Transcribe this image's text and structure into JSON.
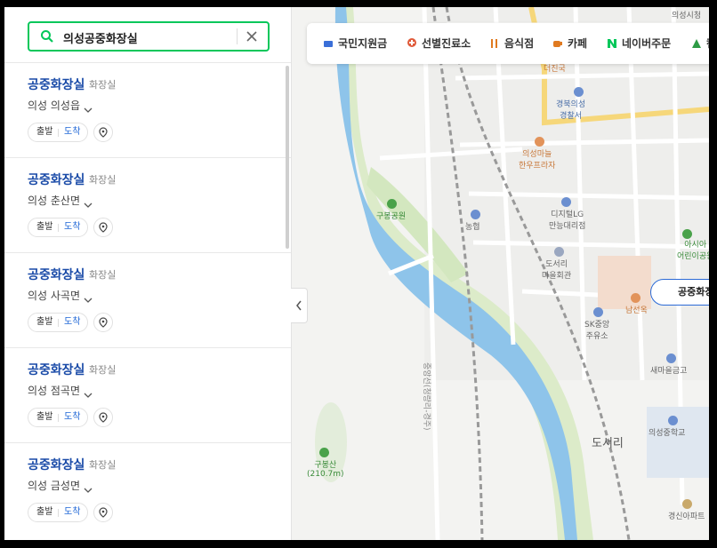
{
  "search": {
    "query": "의성공중화장실"
  },
  "results": [
    {
      "name": "공중화장실",
      "category": "화장실",
      "address": "의성 의성읍",
      "depart": "출발",
      "arrive": "도착"
    },
    {
      "name": "공중화장실",
      "category": "화장실",
      "address": "의성 춘산면",
      "depart": "출발",
      "arrive": "도착"
    },
    {
      "name": "공중화장실",
      "category": "화장실",
      "address": "의성 사곡면",
      "depart": "출발",
      "arrive": "도착"
    },
    {
      "name": "공중화장실",
      "category": "화장실",
      "address": "의성 점곡면",
      "depart": "출발",
      "arrive": "도착"
    },
    {
      "name": "공중화장실",
      "category": "화장실",
      "address": "의성 금성면",
      "depart": "출발",
      "arrive": "도착"
    }
  ],
  "categories": [
    {
      "label": "국민지원금",
      "icon": "wallet-icon",
      "color": "#3a6fd8"
    },
    {
      "label": "선별진료소",
      "icon": "medical-pin-icon",
      "color": "#e05a3a"
    },
    {
      "label": "음식점",
      "icon": "fork-knife-icon",
      "color": "#e07a20"
    },
    {
      "label": "카페",
      "icon": "coffee-cup-icon",
      "color": "#e07a20"
    },
    {
      "label": "네이버주문",
      "icon": "naver-n-icon",
      "color": "#03c75a"
    },
    {
      "label": "캠",
      "icon": "tent-icon",
      "color": "#2e9b46"
    }
  ],
  "map": {
    "labels": {
      "city_hall": "의성시청",
      "dejinguk": "더진국",
      "police": "경북의성\n경찰서",
      "hanwoo": "의성마늘\n한우프라자",
      "digital_lg": "디지털LG\n만능대리점",
      "nonghyup": "농협",
      "gubong_park": "구봉공원",
      "doseori_hall": "도서리\n마을회관",
      "asia_kinder": "아시아\n어린이공원",
      "namseonok": "남선옥",
      "sk_station": "SK중앙\n주유소",
      "saemaul": "새마을금고",
      "doseori": "도서리",
      "uiseong_middle": "의성중학교",
      "gubongsan": "구봉산\n(210.7m)",
      "gyeongsin_apt": "경신아파트",
      "railway": "중앙선(청량리-경주)"
    },
    "pin_label": "공중화장"
  }
}
